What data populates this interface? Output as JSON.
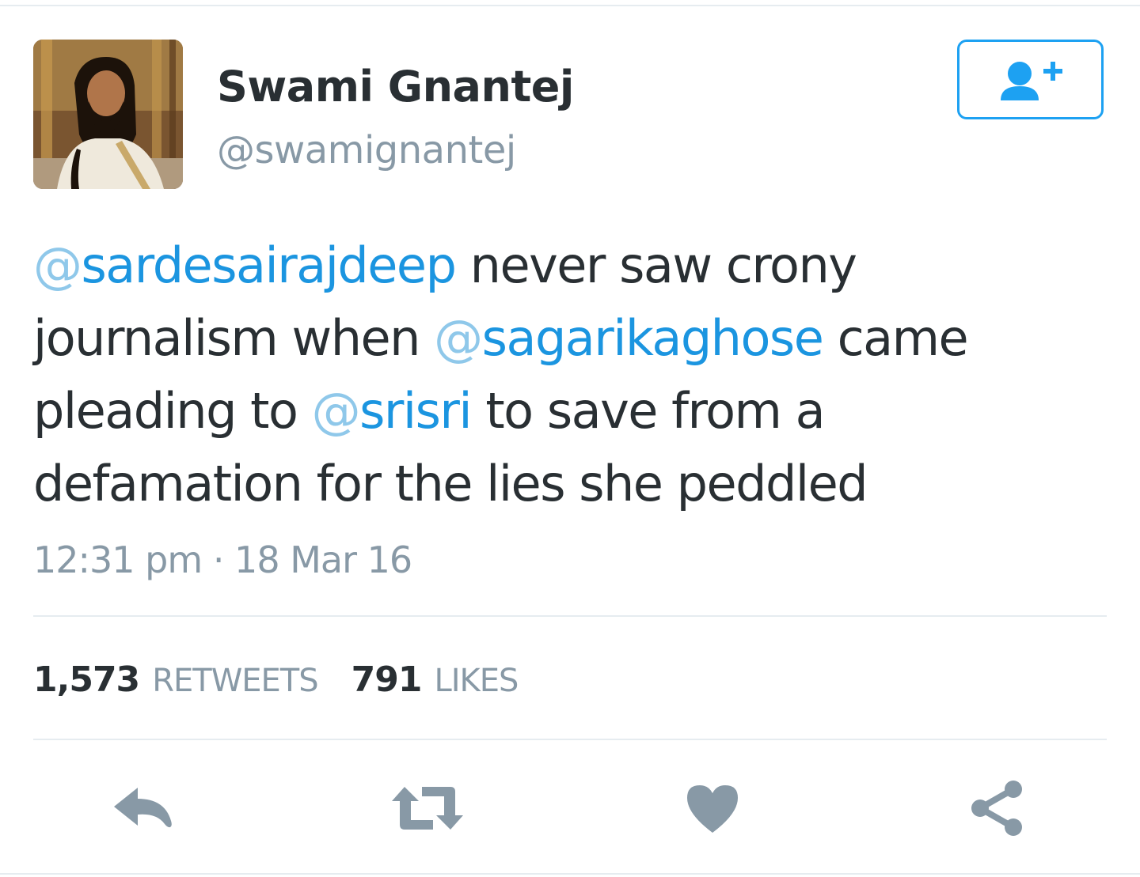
{
  "author": {
    "name": "Swami Gnantej",
    "handle": "@swamignantej",
    "avatar_icon": "profile-photo"
  },
  "follow_button": {
    "icon": "follow-user-plus-icon",
    "color": "#1da1f2"
  },
  "tweet": {
    "segments": [
      {
        "text": "@",
        "kind": "at"
      },
      {
        "text": "sardesairajdeep",
        "kind": "mention"
      },
      {
        "text": " never saw crony journalism when ",
        "kind": "text"
      },
      {
        "text": "@",
        "kind": "at"
      },
      {
        "text": "sagarikaghose",
        "kind": "mention"
      },
      {
        "text": " came pleading to ",
        "kind": "text"
      },
      {
        "text": "@",
        "kind": "at"
      },
      {
        "text": "srisri",
        "kind": "mention"
      },
      {
        "text": " to save from a defamation for the lies she peddled",
        "kind": "text"
      }
    ],
    "timestamp": "12:31 pm · 18 Mar 16"
  },
  "stats": {
    "retweets_count": "1,573",
    "retweets_label": "RETWEETS",
    "likes_count": "791",
    "likes_label": "LIKES"
  },
  "actions": [
    {
      "name": "reply",
      "icon": "reply-icon"
    },
    {
      "name": "retweet",
      "icon": "retweet-icon"
    },
    {
      "name": "like",
      "icon": "heart-icon"
    },
    {
      "name": "share",
      "icon": "share-icon"
    }
  ],
  "colors": {
    "text": "#292f33",
    "secondary": "#8899a6",
    "link": "#1b95e0",
    "divider": "#e6ecf0",
    "icon": "#8899a6"
  }
}
